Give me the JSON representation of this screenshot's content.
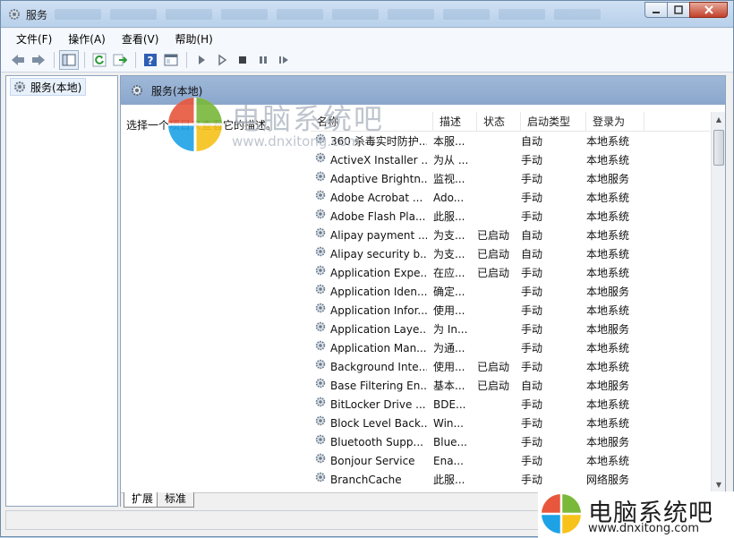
{
  "window": {
    "title": "服务"
  },
  "menu": [
    "文件(F)",
    "操作(A)",
    "查看(V)",
    "帮助(H)"
  ],
  "tree": {
    "root": "服务(本地)"
  },
  "pane": {
    "header": "服务(本地)",
    "description": "选择一个项目来查看它的描述。"
  },
  "table": {
    "columns": [
      "名称",
      "描述",
      "状态",
      "启动类型",
      "登录为"
    ],
    "rows": [
      [
        "360 杀毒实时防护...",
        "本服...",
        "",
        "自动",
        "本地系统"
      ],
      [
        "ActiveX Installer ...",
        "为从 ...",
        "",
        "手动",
        "本地系统"
      ],
      [
        "Adaptive Brightn...",
        "监视...",
        "",
        "手动",
        "本地服务"
      ],
      [
        "Adobe Acrobat ...",
        "Ado...",
        "",
        "手动",
        "本地系统"
      ],
      [
        "Adobe Flash Pla...",
        "此服...",
        "",
        "手动",
        "本地系统"
      ],
      [
        "Alipay payment ...",
        "为支...",
        "已启动",
        "自动",
        "本地系统"
      ],
      [
        "Alipay security b...",
        "为支...",
        "已启动",
        "自动",
        "本地系统"
      ],
      [
        "Application Expe...",
        "在应...",
        "已启动",
        "手动",
        "本地系统"
      ],
      [
        "Application Iden...",
        "确定...",
        "",
        "手动",
        "本地服务"
      ],
      [
        "Application Infor...",
        "使用...",
        "",
        "手动",
        "本地系统"
      ],
      [
        "Application Laye...",
        "为 In...",
        "",
        "手动",
        "本地服务"
      ],
      [
        "Application Man...",
        "为通...",
        "",
        "手动",
        "本地系统"
      ],
      [
        "Background Inte...",
        "使用...",
        "已启动",
        "手动",
        "本地系统"
      ],
      [
        "Base Filtering En...",
        "基本...",
        "已启动",
        "自动",
        "本地服务"
      ],
      [
        "BitLocker Drive ...",
        "BDE...",
        "",
        "手动",
        "本地系统"
      ],
      [
        "Block Level Back...",
        "Win...",
        "",
        "手动",
        "本地系统"
      ],
      [
        "Bluetooth Supp...",
        "Blue...",
        "",
        "手动",
        "本地服务"
      ],
      [
        "Bonjour Service",
        "Ena...",
        "",
        "手动",
        "本地系统"
      ],
      [
        "BranchCache",
        "此服...",
        "",
        "手动",
        "网络服务"
      ]
    ]
  },
  "tabs": [
    "扩展",
    "标准"
  ],
  "watermark": {
    "text": "电脑系统吧",
    "url": "www.dnxitong.com"
  },
  "brand": {
    "name": "电脑系统吧",
    "url": "www.dnxitong.com"
  },
  "colors": {
    "header_bar": "#8aa7cc",
    "title_bar": "#c3d7ee",
    "close_button": "#c2412a"
  }
}
